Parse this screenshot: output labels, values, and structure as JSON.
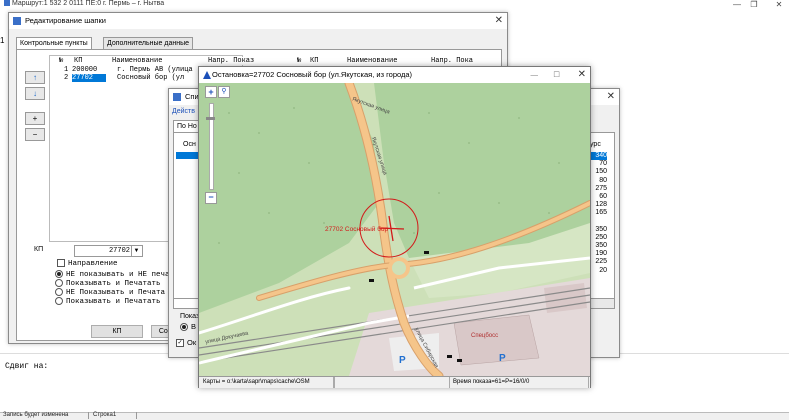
{
  "app": {
    "title": "Маршрут:1 532 2     0111 ПЕ:0 г. Пермь – г. Нытва",
    "strip_label": "1",
    "shift_label": "Сдвиг на:",
    "status": [
      "Запись будет изменена",
      "Строка1"
    ]
  },
  "editor": {
    "title": "Редактирование шапки",
    "tabs": [
      "Контрольные пункты",
      "Дополнительные данные"
    ],
    "columns": [
      "№",
      "КП",
      "Наименование",
      "Напр. Показ"
    ],
    "rows": [
      {
        "n": "1",
        "kp": "200000",
        "name": "г. Пермь АВ (улица"
      },
      {
        "n": "2",
        "kp": "27702",
        "name": "Сосновый бор (ул"
      }
    ],
    "right_columns": [
      "№",
      "КП",
      "Наименование",
      "Напр. Пока"
    ],
    "side_buttons": [
      "↑",
      "↓",
      "+",
      "−"
    ],
    "kp_label": "КП",
    "kp_value": "27702",
    "direction_label": "Направление",
    "options": [
      "НЕ показывать и НЕ печа",
      "Показывать и Печатать",
      "НЕ Показывать и Печата",
      "Показывать и Печатать"
    ],
    "buttons": [
      "КП",
      "Сосн"
    ]
  },
  "middle": {
    "title": "Спи",
    "menu": "Действ",
    "tab": "По Но",
    "header": "Осн",
    "right_header": "урс",
    "right_values": [
      "340",
      "70",
      "150",
      "80",
      "275",
      "60",
      "128",
      "165",
      "",
      "350",
      "250",
      "350",
      "190",
      "225",
      "20"
    ],
    "bottom_label": "Показ",
    "bottom_option": "В",
    "bottom_check": "Ок"
  },
  "map": {
    "title": "Остановка=27702 Сосновый бор (ул.Якутская, из города)",
    "stop_label": "27702 Сосновый бор",
    "street_labels": [
      "Якутская улица",
      "Якутская улица",
      "улица Докучаева",
      "улица Сибирская"
    ],
    "place_label": "Спецбосс",
    "parking": [
      "P",
      "P"
    ],
    "status_left": "Карты = o:\\karta\\sapr\\maps\\cache\\OSM",
    "status_right": "Время показа=61=P=16/0/0",
    "colors": {
      "road": "#f5c58a",
      "road_edge": "#d8a06a",
      "forest": "#add19e",
      "meadow": "#cde0b8",
      "rail": "#8a8a8a",
      "target": "#d21a1a"
    }
  }
}
